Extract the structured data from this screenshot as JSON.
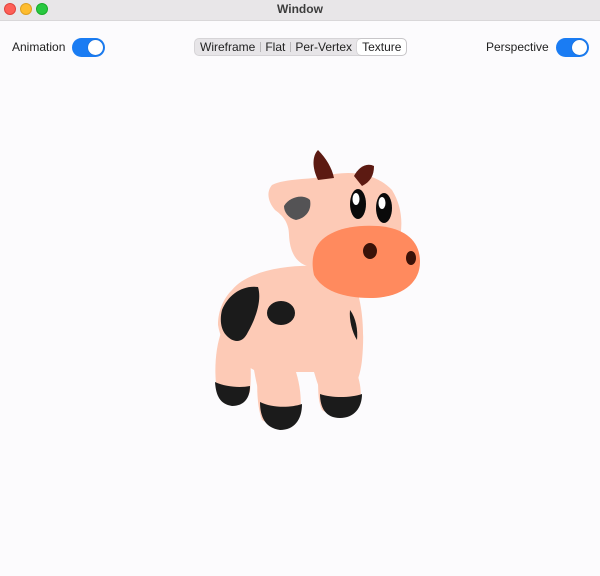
{
  "window": {
    "title": "Window"
  },
  "toolbar": {
    "animation": {
      "label": "Animation",
      "on": true
    },
    "render_modes": [
      {
        "label": "Wireframe",
        "selected": false
      },
      {
        "label": "Flat",
        "selected": false
      },
      {
        "label": "Per-Vertex",
        "selected": false
      },
      {
        "label": "Texture",
        "selected": true
      }
    ],
    "perspective": {
      "label": "Perspective",
      "on": true
    }
  },
  "colors": {
    "accent": "#1a7cf3",
    "cow_body": "#fdcab6",
    "cow_muzzle": "#ff8a5e",
    "cow_spots": "#1b1b1b",
    "cow_horns": "#5c1a12",
    "background": "#fcfbfd"
  }
}
